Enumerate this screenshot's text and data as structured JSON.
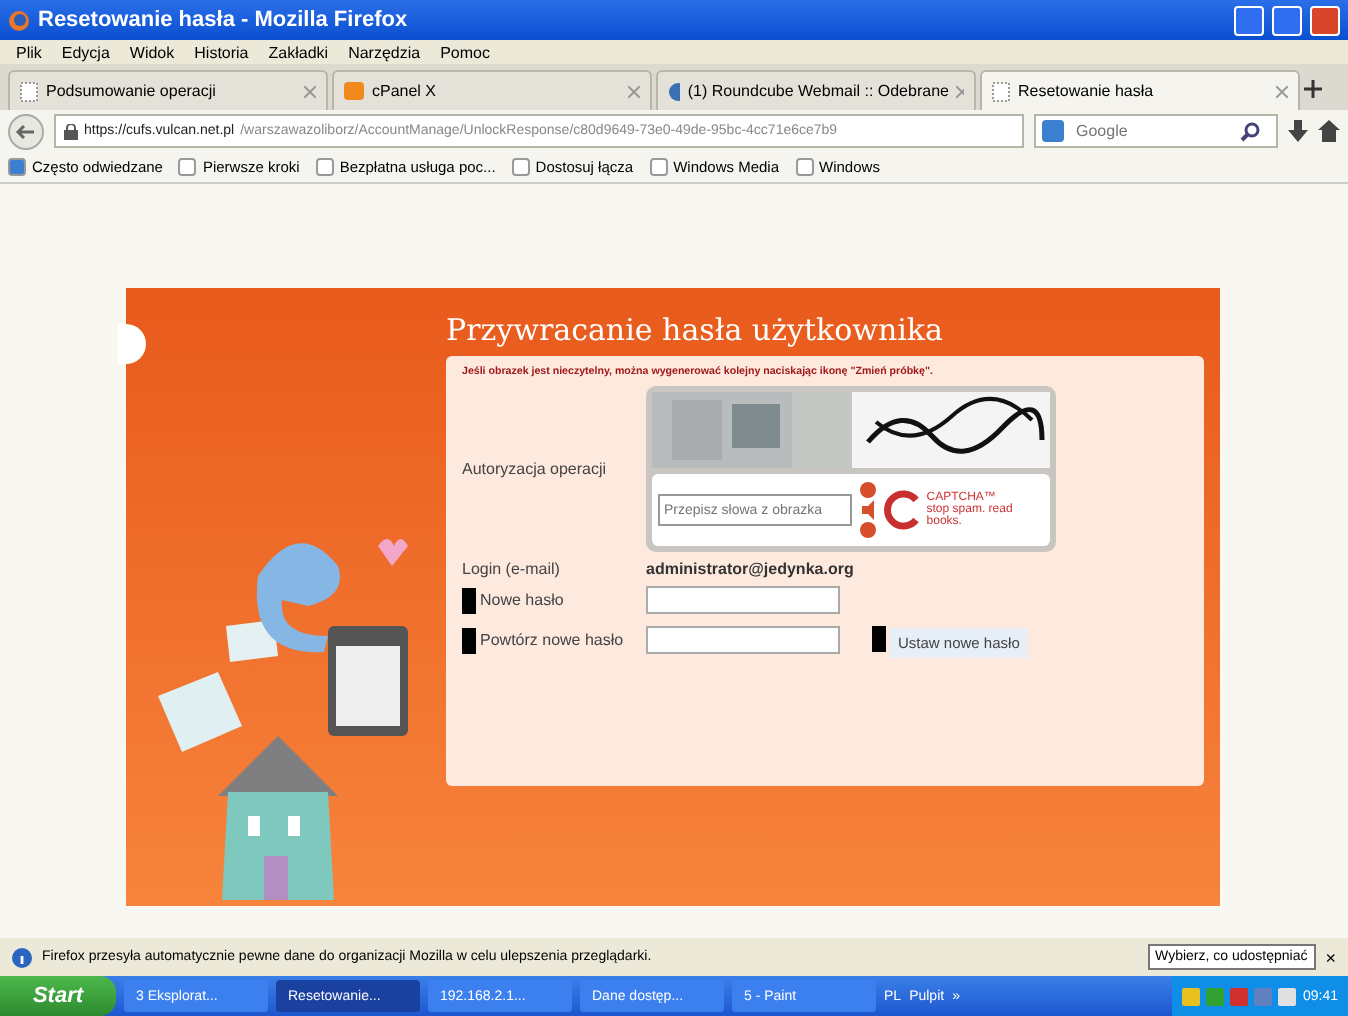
{
  "window": {
    "title": "Resetowanie hasła - Mozilla Firefox"
  },
  "menu": [
    "Plik",
    "Edycja",
    "Widok",
    "Historia",
    "Zakładki",
    "Narzędzia",
    "Pomoc"
  ],
  "tabs": [
    {
      "label": "Podsumowanie operacji",
      "selected": false,
      "kind": "blank"
    },
    {
      "label": "cPanel X",
      "selected": false,
      "kind": "cpanel"
    },
    {
      "label": "(1) Roundcube Webmail :: Odebrane",
      "selected": false,
      "kind": "roundcube"
    },
    {
      "label": "Resetowanie hasła",
      "selected": true,
      "kind": "blank"
    }
  ],
  "address": {
    "host": "https://cufs.vulcan.net.pl",
    "path": "/warszawazoliborz/AccountManage/UnlockResponse/c80d9649-73e0-49de-95bc-4cc71e6ce7b9"
  },
  "search": {
    "placeholder": "Google"
  },
  "bookmarks": [
    {
      "label": "Często odwiedzane",
      "kind": "special"
    },
    {
      "label": "Pierwsze kroki",
      "kind": "page"
    },
    {
      "label": "Bezpłatna usługa poc...",
      "kind": "page"
    },
    {
      "label": "Dostosuj łącza",
      "kind": "page"
    },
    {
      "label": "Windows Media",
      "kind": "page"
    },
    {
      "label": "Windows",
      "kind": "page"
    }
  ],
  "form": {
    "title": "Przywracanie hasła użytkownika",
    "hint": "Jeśli obrazek jest nieczytelny, można wygenerować kolejny naciskając ikonę \"Zmień próbkę\".",
    "captcha_label": "Autoryzacja operacji",
    "captcha_placeholder": "Przepisz słowa z obrazka",
    "captcha_brand": "CAPTCHA™",
    "captcha_slogan": "stop spam. read books.",
    "login_label": "Login (e-mail)",
    "login_value": "administrator@jedynka.org",
    "new_password_label": "Nowe hasło",
    "repeat_password_label": "Powtórz nowe hasło",
    "submit": "Ustaw nowe hasło"
  },
  "notification": {
    "text": "Firefox przesyła automatycznie pewne dane do organizacji Mozilla w celu ulepszenia przeglądarki.",
    "button": "Wybierz, co udostępniać",
    "close": "×"
  },
  "taskbar": {
    "start": "Start",
    "items": [
      {
        "label": "3 Eksplorat...",
        "selected": false
      },
      {
        "label": "Resetowanie...",
        "selected": true
      },
      {
        "label": "192.168.2.1...",
        "selected": false
      },
      {
        "label": "Dane dostęp...",
        "selected": false
      },
      {
        "label": "5 - Paint",
        "selected": false
      }
    ],
    "lang": "PL",
    "desktop": "Pulpit",
    "more": "»",
    "clock": "09:41"
  }
}
